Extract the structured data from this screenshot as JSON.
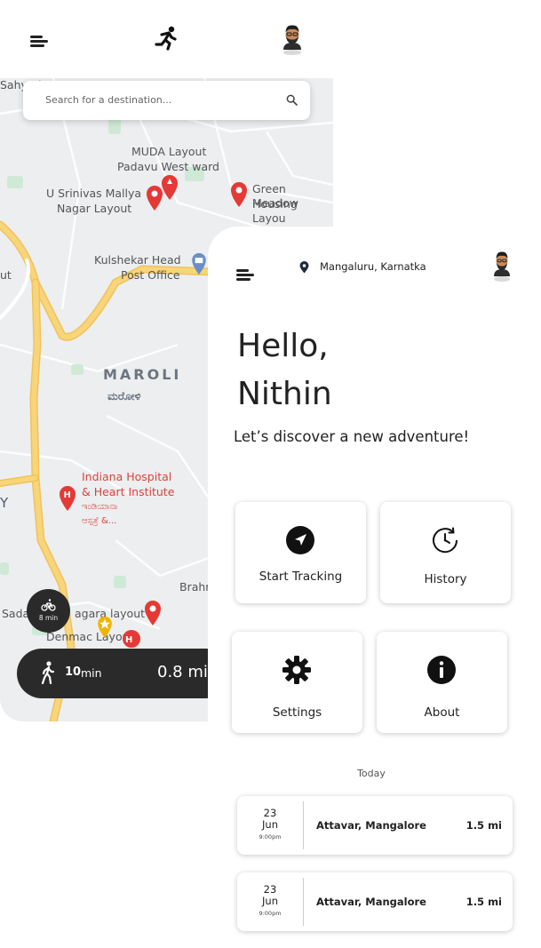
{
  "header": {
    "menu_icon": "hamburger-icon",
    "logo_icon": "running-person-icon",
    "avatar_icon": "bearded-man-avatar"
  },
  "map": {
    "search": {
      "placeholder": "Search for a destination..."
    },
    "labels": {
      "sahyadri": "Sahyad",
      "muda_1": "MUDA Layout",
      "muda_2": "Padavu West ward",
      "mallya_1": "U Srinivas Mallya",
      "mallya_2": "Nagar Layout",
      "green_1": "Green Meadow",
      "green_2": "Housing Layou",
      "kulshekar_1": "Kulshekar Head",
      "kulshekar_2": "Post Office",
      "ut": "ut",
      "maroli": "MAROLI",
      "maroli_kn": "ಮರೋಳಿ",
      "indiana_1": "Indiana Hospital",
      "indiana_2": "& Heart Institute",
      "indiana_3": "ಇಂಡಿಯಾನಾ",
      "indiana_4": "ಆಸ್ಪತ್ರೆ &...",
      "y": "Y",
      "brahm": "Brahm",
      "sada": "Sada",
      "nagara": "agara layout",
      "denmac": "Denmac Layout"
    },
    "bike": {
      "icon": "bicycle-icon",
      "time": "8 min"
    },
    "walk": {
      "icon": "walking-person-icon",
      "time_num": "10",
      "time_unit": "min",
      "distance": "0.8 mi"
    },
    "colors": {
      "road": "#f8d57a",
      "road_edge": "#f0c35a",
      "park": "#cfe9d6",
      "pin": "#e53935"
    }
  },
  "home": {
    "location": "Mangaluru, Karnatka",
    "greeting_line1": "Hello,",
    "greeting_line2": "Nithin",
    "tagline": "Let’s discover a new adventure!",
    "cards": {
      "start": {
        "label": "Start Tracking",
        "icon": "navigation-arrow-icon"
      },
      "history": {
        "label": "History",
        "icon": "clock-history-icon"
      },
      "settings": {
        "label": "Settings",
        "icon": "gear-icon"
      },
      "about": {
        "label": "About",
        "icon": "info-icon"
      }
    },
    "today_label": "Today",
    "trips": [
      {
        "day": "23",
        "month": "Jun",
        "time": "9:00pm",
        "place": "Attavar, Mangalore",
        "distance": "1.5 mi"
      },
      {
        "day": "23",
        "month": "Jun",
        "time": "9:00pm",
        "place": "Attavar, Mangalore",
        "distance": "1.5 mi"
      }
    ]
  }
}
